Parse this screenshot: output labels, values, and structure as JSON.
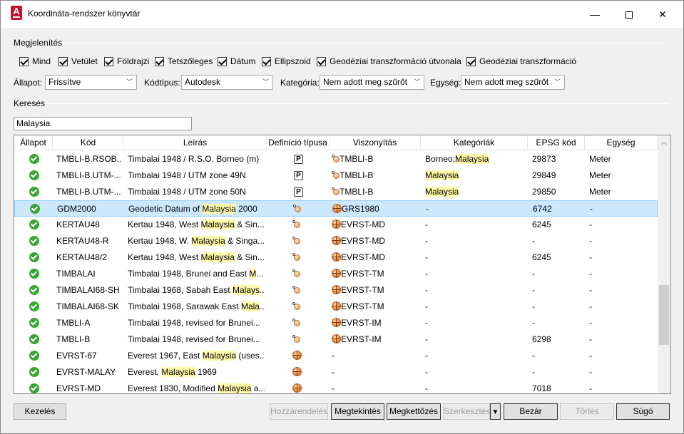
{
  "window": {
    "title": "Koordináta-rendszer könyvtár",
    "minimize": "—",
    "close": "✕",
    "app_icon_letter": "A"
  },
  "display": {
    "label": "Megjelenítés",
    "checkboxes": [
      {
        "label": "Mind",
        "checked": true
      },
      {
        "label": "Vetület",
        "checked": true
      },
      {
        "label": "Földrajzi",
        "checked": true
      },
      {
        "label": "Tetszőleges",
        "checked": true
      },
      {
        "label": "Dátum",
        "checked": true
      },
      {
        "label": "Ellipszoid",
        "checked": true
      },
      {
        "label": "Geodéziai transzformáció útvonala",
        "checked": true
      },
      {
        "label": "Geodéziai transzformáció",
        "checked": true
      }
    ]
  },
  "filters": {
    "status_label": "Állapot:",
    "status_value": "Frissítve",
    "codetype_label": "Kódtípus:",
    "codetype_value": "Autodesk",
    "category_label": "Kategória:",
    "category_value": "Nem adott meg szűrőt",
    "unit_label": "Egység:",
    "unit_value": "Nem adott meg szűrőt"
  },
  "search": {
    "label": "Keresés",
    "value": "Malaysia"
  },
  "table": {
    "columns": [
      "Állapot",
      "Kód",
      "Leírás",
      "Definíció típusa",
      "Viszonyítás",
      "Kategóriák",
      "EPSG kód",
      "Egység"
    ],
    "rows": [
      {
        "code": "TMBLI-B.RSOB...",
        "desc": [
          "Timbalai 1948 / R.S.O. Borneo (m)"
        ],
        "deftype": "P",
        "ref_icon": "geo-small",
        "ref": "TMBLI-B",
        "cat": [
          "Borneo;",
          "Malaysia"
        ],
        "epsg": "29873",
        "unit": "Meter",
        "selected": false
      },
      {
        "code": "TMBLI-B.UTM-...",
        "desc": [
          "Timbalai 1948 / UTM zone 49N"
        ],
        "deftype": "P",
        "ref_icon": "geo-small",
        "ref": "TMBLI-B",
        "cat": [
          "",
          "Malaysia"
        ],
        "epsg": "29849",
        "unit": "Meter",
        "selected": false
      },
      {
        "code": "TMBLI-B.UTM-...",
        "desc": [
          "Timbalai 1948 / UTM zone 50N"
        ],
        "deftype": "P",
        "ref_icon": "geo-small",
        "ref": "TMBLI-B",
        "cat": [
          "",
          "Malaysia"
        ],
        "epsg": "29850",
        "unit": "Meter",
        "selected": false
      },
      {
        "code": "GDM2000",
        "desc": [
          "Geodetic Datum of ",
          "Malaysia",
          " 2000"
        ],
        "deftype": "geo-small",
        "ref_icon": "globe",
        "ref": "GRS1980",
        "cat": [
          "-",
          ""
        ],
        "epsg": "6742",
        "unit": "-",
        "selected": true
      },
      {
        "code": "KERTAU48",
        "desc": [
          "Kertau 1948, West ",
          "Malaysia",
          " & Sin..."
        ],
        "deftype": "geo-small",
        "ref_icon": "globe",
        "ref": "EVRST-MD",
        "cat": [
          "-",
          ""
        ],
        "epsg": "6245",
        "unit": "-",
        "selected": false
      },
      {
        "code": "KERTAU48-R",
        "desc": [
          "Kertau 1948, W. ",
          "Malaysia",
          " & Singa..."
        ],
        "deftype": "geo-small",
        "ref_icon": "globe",
        "ref": "EVRST-MD",
        "cat": [
          "-",
          ""
        ],
        "epsg": "-",
        "unit": "-",
        "selected": false
      },
      {
        "code": "KERTAU48/2",
        "desc": [
          "Kertau 1948, West ",
          "Malaysia",
          " & Sin..."
        ],
        "deftype": "geo-small",
        "ref_icon": "globe",
        "ref": "EVRST-MD",
        "cat": [
          "-",
          ""
        ],
        "epsg": "6245",
        "unit": "-",
        "selected": false
      },
      {
        "code": "TIMBALAI",
        "desc": [
          "Timbalai 1948, Brunei and East ",
          "M",
          "..."
        ],
        "deftype": "geo-small",
        "ref_icon": "globe",
        "ref": "EVRST-TM",
        "cat": [
          "-",
          ""
        ],
        "epsg": "-",
        "unit": "-",
        "selected": false
      },
      {
        "code": "TIMBALAI68-SH",
        "desc": [
          "Timbalai 1968, Sabah East ",
          "Malays",
          "..."
        ],
        "deftype": "geo-small",
        "ref_icon": "globe",
        "ref": "EVRST-TM",
        "cat": [
          "-",
          ""
        ],
        "epsg": "-",
        "unit": "-",
        "selected": false
      },
      {
        "code": "TIMBALAI68-SK",
        "desc": [
          "Timbalai 1968, Sarawak East ",
          "Mala",
          "..."
        ],
        "deftype": "geo-small",
        "ref_icon": "globe",
        "ref": "EVRST-TM",
        "cat": [
          "-",
          ""
        ],
        "epsg": "-",
        "unit": "-",
        "selected": false
      },
      {
        "code": "TMBLI-A",
        "desc": [
          "Timbalai 1948, revised for Brunei..."
        ],
        "deftype": "geo-small",
        "ref_icon": "globe",
        "ref": "EVRST-IM",
        "cat": [
          "-",
          ""
        ],
        "epsg": "-",
        "unit": "-",
        "selected": false
      },
      {
        "code": "TMBLI-B",
        "desc": [
          "Timbalai 1948, revised for Brunei..."
        ],
        "deftype": "geo-small",
        "ref_icon": "globe",
        "ref": "EVRST-IM",
        "cat": [
          "-",
          ""
        ],
        "epsg": "6298",
        "unit": "-",
        "selected": false
      },
      {
        "code": "EVRST-67",
        "desc": [
          "Everest 1967, East ",
          "Malaysia",
          " (uses..."
        ],
        "deftype": "globe",
        "ref_icon": "",
        "ref": "-",
        "cat": [
          "-",
          ""
        ],
        "epsg": "-",
        "unit": "-",
        "selected": false
      },
      {
        "code": "EVRST-MALAY",
        "desc": [
          "Everest, ",
          "Malaysia",
          " 1969"
        ],
        "deftype": "globe",
        "ref_icon": "",
        "ref": "-",
        "cat": [
          "-",
          ""
        ],
        "epsg": "-",
        "unit": "-",
        "selected": false
      },
      {
        "code": "EVRST-MD",
        "desc": [
          "Everest 1830, Modified ",
          "Malaysia",
          " a..."
        ],
        "deftype": "globe",
        "ref_icon": "",
        "ref": "-",
        "cat": [
          "-",
          ""
        ],
        "epsg": "7018",
        "unit": "-",
        "selected": false
      }
    ]
  },
  "buttons": {
    "manage": "Kezelés",
    "assign": "Hozzárendelés",
    "view": "Megtekintés",
    "duplicate": "Megkettőzés",
    "edit": "Szerkesztés",
    "edit_dropdown": "▼",
    "close": "Bezár",
    "delete": "Törlés",
    "help": "Súgó"
  }
}
